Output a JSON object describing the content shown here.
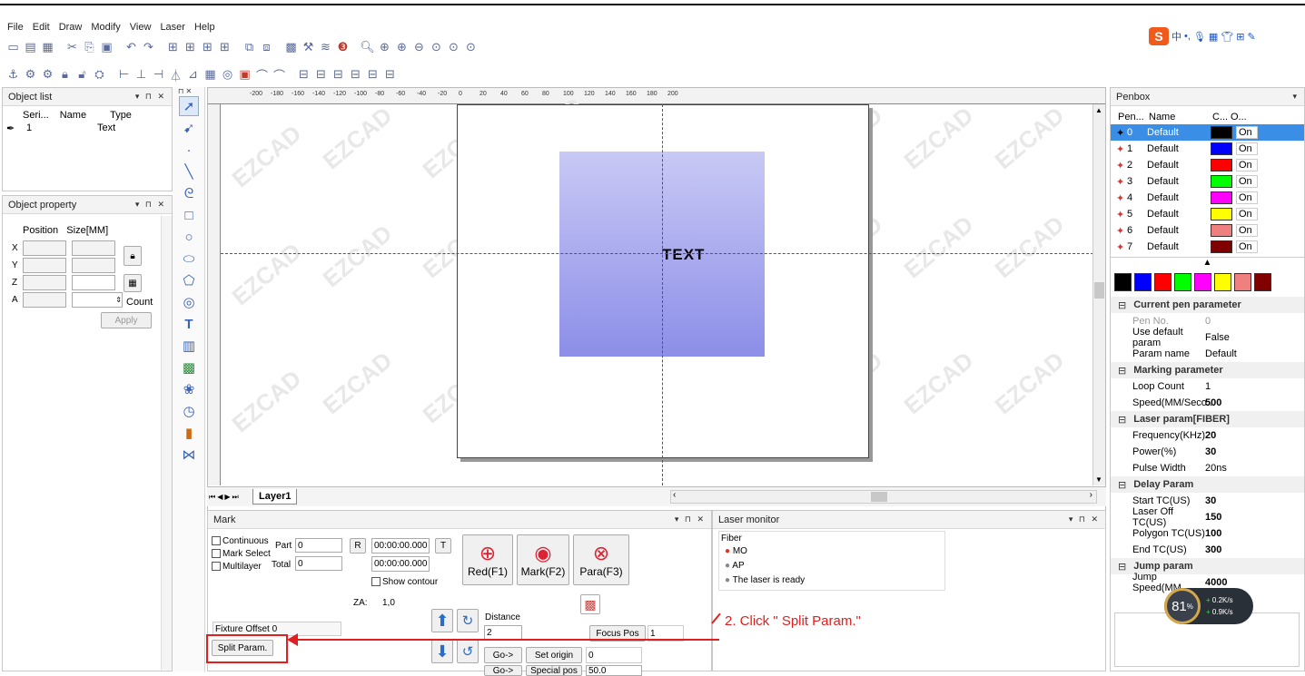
{
  "menu": [
    "File",
    "Edit",
    "Draw",
    "Modify",
    "View",
    "Laser",
    "Help"
  ],
  "panels": {
    "object_list": {
      "title": "Object list",
      "columns": [
        "Seri...",
        "Name",
        "Type"
      ],
      "rows": [
        {
          "serial": "1",
          "name": "",
          "type": "Text"
        }
      ]
    },
    "object_property": {
      "title": "Object property",
      "header": "Position   Size[MM]",
      "labels": [
        "X",
        "Y",
        "Z",
        "A"
      ],
      "count_label": "Count",
      "apply_label": "Apply"
    }
  },
  "canvas": {
    "top_ruler": [
      "-200",
      "-180",
      "-160",
      "-140",
      "-120",
      "-100",
      "-80",
      "-60",
      "-40",
      "-20",
      "0",
      "20",
      "40",
      "60",
      "80",
      "100",
      "120",
      "140",
      "160",
      "180",
      "200"
    ],
    "text_object": "TEXT",
    "watermark": "EZCAD",
    "layer_tab": "Layer1"
  },
  "mark": {
    "title": "Mark",
    "continuous": "Continuous",
    "mark_select": "Mark Select",
    "multilayer": "Multilayer",
    "part_label": "Part",
    "part_value": "0",
    "total_label": "Total",
    "total_value": "0",
    "r_btn": "R",
    "t_btn": "T",
    "time1": "00:00:00.000",
    "time2": "00:00:00.000",
    "show_contour": "Show contour",
    "red_btn": "Red(F1)",
    "mark_btn": "Mark(F2)",
    "para_btn": "Para(F3)",
    "za_label": "ZA:",
    "za_value": "1,0",
    "distance_label": "Distance",
    "distance_value": "2",
    "focus_pos": "Focus Pos",
    "focus_value": "1",
    "fixture_offset": "Fixture Offset",
    "fixture_value": "0",
    "split_param": "Split Param.",
    "go_btn": "Go->",
    "set_origin": "Set origin",
    "origin_value": "0",
    "go_btn2": "Go->",
    "special_pos": "Special pos",
    "special_value": "50.0"
  },
  "laser_monitor": {
    "title": "Laser monitor",
    "group": "Fiber",
    "items": [
      "MO",
      "AP",
      "The laser is ready"
    ]
  },
  "penbox": {
    "title": "Penbox",
    "columns": [
      "Pen...",
      "Name",
      "C...",
      "O..."
    ],
    "pens": [
      {
        "no": "0",
        "name": "Default",
        "color": "#000000",
        "on": "On"
      },
      {
        "no": "1",
        "name": "Default",
        "color": "#0000ff",
        "on": "On"
      },
      {
        "no": "2",
        "name": "Default",
        "color": "#ff0000",
        "on": "On"
      },
      {
        "no": "3",
        "name": "Default",
        "color": "#00ff00",
        "on": "On"
      },
      {
        "no": "4",
        "name": "Default",
        "color": "#ff00ff",
        "on": "On"
      },
      {
        "no": "5",
        "name": "Default",
        "color": "#ffff00",
        "on": "On"
      },
      {
        "no": "6",
        "name": "Default",
        "color": "#f08080",
        "on": "On"
      },
      {
        "no": "7",
        "name": "Default",
        "color": "#800000",
        "on": "On"
      }
    ],
    "swatches": [
      "#000000",
      "#0000ff",
      "#ff0000",
      "#00ff00",
      "#ff00ff",
      "#ffff00",
      "#f08080",
      "#800000"
    ],
    "params": [
      {
        "cat": "Current pen parameter"
      },
      {
        "k": "Pen No.",
        "v": "0",
        "grey": true
      },
      {
        "k": "Use default param",
        "v": "False"
      },
      {
        "k": "Param name",
        "v": "Default"
      },
      {
        "cat": "Marking parameter"
      },
      {
        "k": "Loop Count",
        "v": "1"
      },
      {
        "k": "Speed(MM/Seco...",
        "v": "500",
        "bold": true
      },
      {
        "cat": "Laser param[FIBER]"
      },
      {
        "k": "Frequency(KHz)",
        "v": "20",
        "bold": true
      },
      {
        "k": "Power(%)",
        "v": "30",
        "bold": true
      },
      {
        "k": "Pulse Width",
        "v": "20ns"
      },
      {
        "cat": "Delay Param"
      },
      {
        "k": "Start TC(US)",
        "v": "30",
        "bold": true
      },
      {
        "k": "Laser Off TC(US)",
        "v": "150",
        "bold": true
      },
      {
        "k": "Polygon TC(US)",
        "v": "100",
        "bold": true
      },
      {
        "k": "End TC(US)",
        "v": "300",
        "bold": true
      },
      {
        "cat": "Jump param"
      },
      {
        "k": "Jump Speed(MM...",
        "v": "4000",
        "bold": true
      }
    ]
  },
  "net_widget": {
    "percent": "81",
    "unit": "%",
    "up": "0.2K/s",
    "down": "0.9K/s"
  },
  "annotation": "2. Click \" Split Param.\""
}
